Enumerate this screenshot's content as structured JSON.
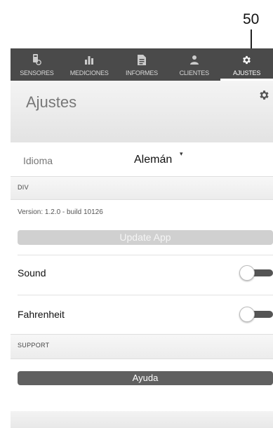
{
  "callout": {
    "number": "50"
  },
  "tabs": [
    {
      "label": "SENSORES",
      "icon": "sensor-icon"
    },
    {
      "label": "MEDICIONES",
      "icon": "bar-chart-icon"
    },
    {
      "label": "INFORMES",
      "icon": "report-icon"
    },
    {
      "label": "CLIENTES",
      "icon": "clients-icon"
    },
    {
      "label": "AJUSTES",
      "icon": "gear-icon",
      "active": true
    }
  ],
  "header": {
    "title": "Ajustes"
  },
  "language": {
    "label": "Idioma",
    "value": "Alemán"
  },
  "sections": {
    "div": "DIV",
    "support": "SUPPORT"
  },
  "version": {
    "text": "Version: 1.2.0 - build 10126"
  },
  "buttons": {
    "update": "Update App",
    "help": "Ayuda"
  },
  "toggles": {
    "sound": {
      "label": "Sound",
      "on": false
    },
    "fahrenheit": {
      "label": "Fahrenheit",
      "on": false
    }
  },
  "colors": {
    "tabbar": "#4a4a4a",
    "active_tab": "#ffffff",
    "help_button": "#606060",
    "update_button": "#d0d0d0"
  }
}
